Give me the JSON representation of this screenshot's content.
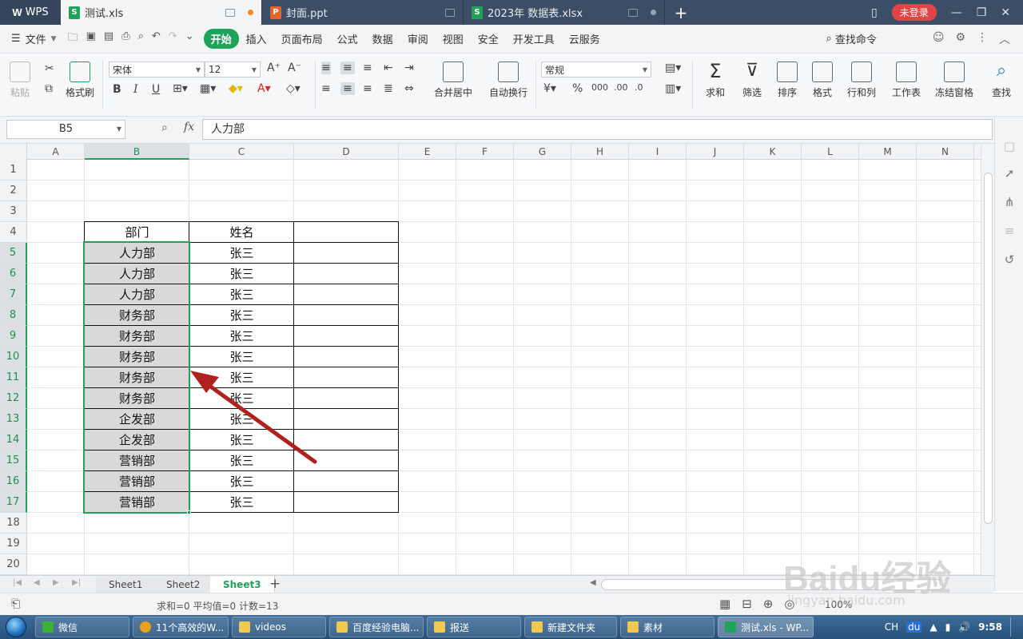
{
  "titlebar": {
    "app": "WPS",
    "tabs": [
      {
        "label": "测试.xls",
        "type": "s",
        "active": true
      },
      {
        "label": "封面.ppt",
        "type": "p",
        "active": false
      },
      {
        "label": "2023年 数据表.xlsx",
        "type": "s",
        "active": false
      }
    ],
    "login": "未登录"
  },
  "menubar": {
    "file": "文件",
    "items": [
      "开始",
      "插入",
      "页面布局",
      "公式",
      "数据",
      "审阅",
      "视图",
      "安全",
      "开发工具",
      "云服务"
    ],
    "search": "查找命令"
  },
  "ribbon": {
    "paste": "粘贴",
    "format_painter": "格式刷",
    "font_name": "宋体",
    "font_size": "12",
    "merge_center": "合并居中",
    "wrap": "自动换行",
    "number_format": "常规",
    "sum": "求和",
    "filter": "筛选",
    "sort": "排序",
    "format": "格式",
    "rowcol": "行和列",
    "worksheet": "工作表",
    "freeze": "冻结窗格",
    "find": "查找"
  },
  "formulabar": {
    "namebox": "B5",
    "fx": "fx",
    "value": "人力部"
  },
  "grid": {
    "columns": [
      "A",
      "B",
      "C",
      "D",
      "E",
      "F",
      "G",
      "H",
      "I",
      "J",
      "K",
      "L",
      "M",
      "N"
    ],
    "rows": [
      "1",
      "2",
      "3",
      "4",
      "5",
      "6",
      "7",
      "8",
      "9",
      "10",
      "11",
      "12",
      "13",
      "14",
      "15",
      "16",
      "17",
      "18",
      "19",
      "20"
    ],
    "header": {
      "dept": "部门",
      "name": "姓名"
    },
    "data": [
      {
        "dept": "人力部",
        "name": "张三"
      },
      {
        "dept": "人力部",
        "name": "张三"
      },
      {
        "dept": "人力部",
        "name": "张三"
      },
      {
        "dept": "财务部",
        "name": "张三"
      },
      {
        "dept": "财务部",
        "name": "张三"
      },
      {
        "dept": "财务部",
        "name": "张三"
      },
      {
        "dept": "财务部",
        "name": "张三"
      },
      {
        "dept": "财务部",
        "name": "张三"
      },
      {
        "dept": "企发部",
        "name": "张三"
      },
      {
        "dept": "企发部",
        "name": "张三"
      },
      {
        "dept": "营销部",
        "name": "张三"
      },
      {
        "dept": "营销部",
        "name": "张三"
      },
      {
        "dept": "营销部",
        "name": "张三"
      }
    ]
  },
  "sheets": [
    "Sheet1",
    "Sheet2",
    "Sheet3"
  ],
  "active_sheet": "Sheet3",
  "status": {
    "text": "求和=0  平均值=0  计数=13",
    "zoom": "100%"
  },
  "taskbar": {
    "items": [
      "微信",
      "11个高效的W...",
      "videos",
      "百度经验电脑...",
      "报送",
      "新建文件夹",
      "素材",
      "测试.xls - WP..."
    ],
    "clock": "9:58",
    "lang": "CH"
  },
  "watermark": {
    "main": "Baidu经验",
    "sub": "jingyan.baidu.com"
  },
  "colors": {
    "accent": "#1fa35b",
    "titlebar": "#3c4e66",
    "arrow": "#b0201c"
  }
}
